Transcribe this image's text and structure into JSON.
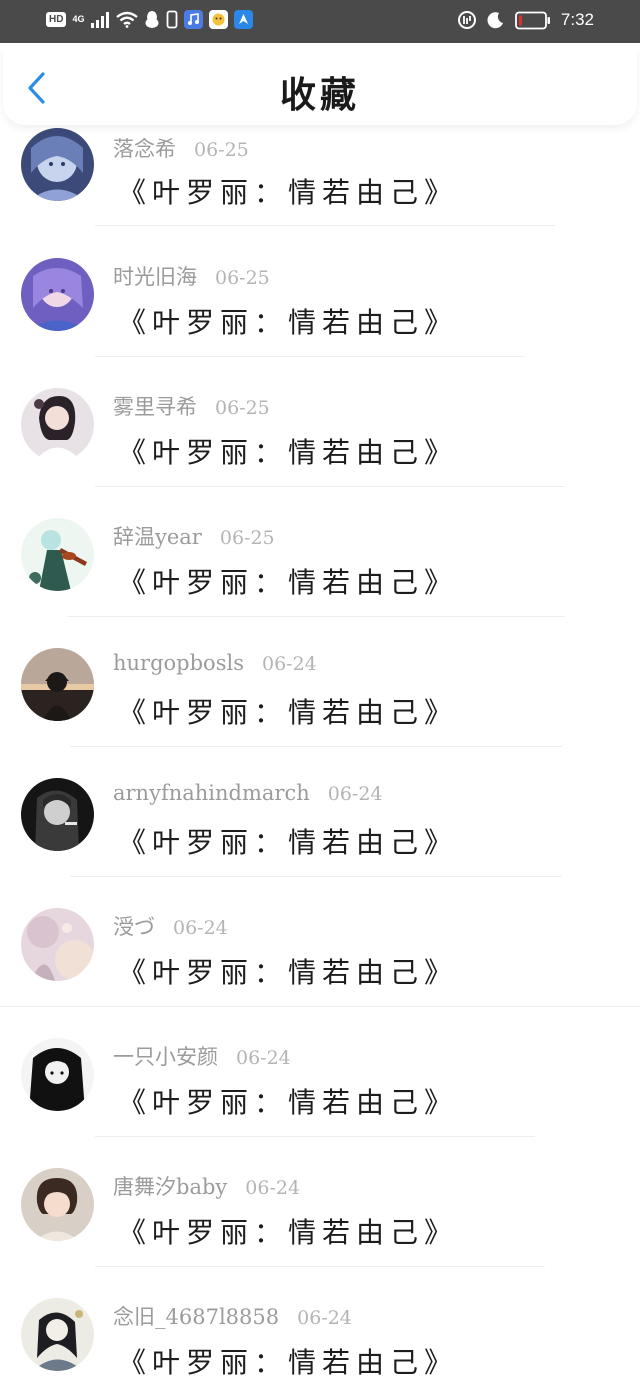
{
  "status_bar": {
    "hd": "HD",
    "network": "4G",
    "time": "7:32"
  },
  "header": {
    "title": "收藏"
  },
  "colors": {
    "accent": "#2b8ee6",
    "status_bar_bg": "#4a4a4a",
    "battery_low": "#e0302e"
  },
  "favorites": [
    {
      "username": "落念希",
      "date": "06-25",
      "book": "《叶罗丽：情若由己》",
      "avatar": "anime-girl-blue"
    },
    {
      "username": "时光旧海",
      "date": "06-25",
      "book": "《叶罗丽：情若由己》",
      "avatar": "anime-girl-purple"
    },
    {
      "username": "雾里寻希",
      "date": "06-25",
      "book": "《叶罗丽：情若由己》",
      "avatar": "girl-white-dress"
    },
    {
      "username": "辞温year",
      "date": "06-25",
      "book": "《叶罗丽：情若由己》",
      "avatar": "violin-girl"
    },
    {
      "username": "hurgopbosls",
      "date": "06-24",
      "book": "《叶罗丽：情若由己》",
      "avatar": "sunset-silhouette"
    },
    {
      "username": "arnyfnahindmarch",
      "date": "06-24",
      "book": "《叶罗丽：情若由己》",
      "avatar": "dark-portrait"
    },
    {
      "username": "涭づ",
      "date": "06-24",
      "book": "《叶罗丽：情若由己》",
      "avatar": "pastel-scene"
    },
    {
      "username": "一只小安颜",
      "date": "06-24",
      "book": "《叶罗丽：情若由己》",
      "avatar": "dark-anime-girl"
    },
    {
      "username": "唐舞汐baby",
      "date": "06-24",
      "book": "《叶罗丽：情若由己》",
      "avatar": "short-hair-girl"
    },
    {
      "username": "念旧_4687l8858",
      "date": "06-24",
      "book": "《叶罗丽：情若由己》",
      "avatar": "ink-art-girl"
    }
  ]
}
